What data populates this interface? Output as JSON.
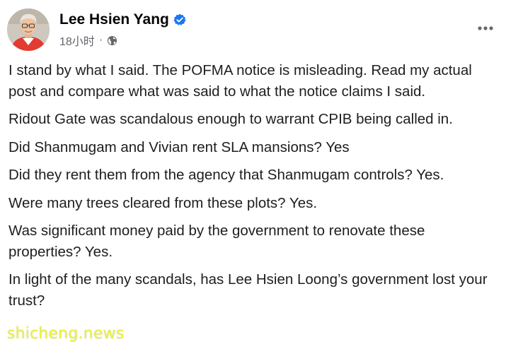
{
  "post": {
    "author": "Lee Hsien Yang",
    "verified": true,
    "timestamp": "18小时",
    "separator": "·",
    "audience_icon": "globe-icon",
    "more_icon": "more-horizontal-icon",
    "paragraphs": [
      "I stand by what I said. The POFMA notice is misleading. Read my actual post and compare what was said to what the notice claims I said.",
      "Ridout Gate was scandalous enough to warrant CPIB being called in.",
      "Did Shanmugam and Vivian rent SLA mansions? Yes",
      "Did they rent them from the agency that Shanmugam controls? Yes.",
      "Were many trees cleared from these plots? Yes.",
      "Was significant money paid by the government to renovate these properties? Yes.",
      "In light of the many scandals, has Lee Hsien Loong’s government lost your trust?"
    ]
  },
  "watermark": "shicheng.news",
  "colors": {
    "text": "#1c1e21",
    "secondary": "#65676b",
    "verified_blue": "#1877f2",
    "watermark": "#e9f032"
  }
}
